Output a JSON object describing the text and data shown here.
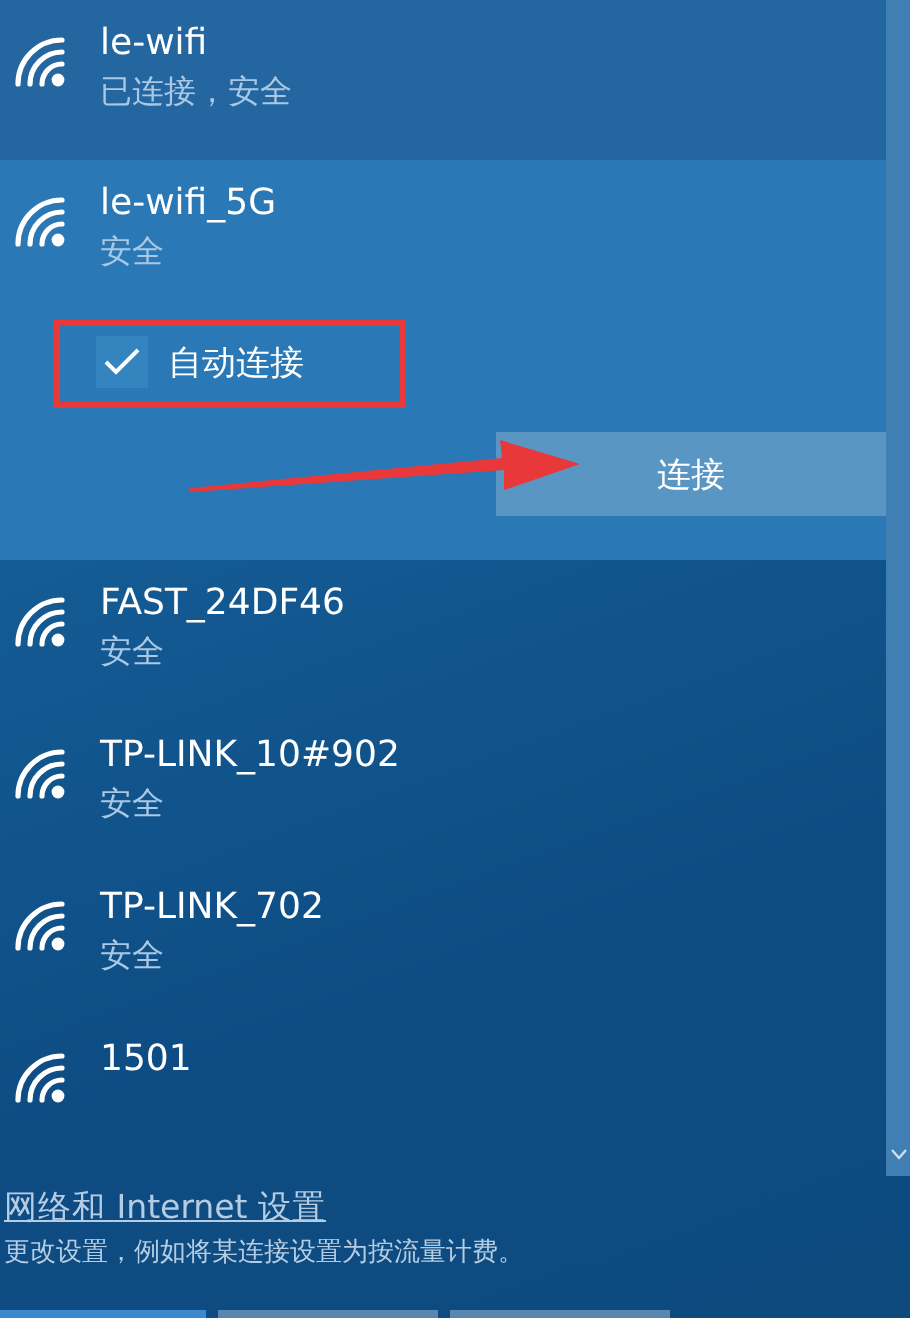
{
  "networks": [
    {
      "name": "le-wifi",
      "status": "已连接，安全",
      "connected": true,
      "selected": false
    },
    {
      "name": "le-wifi_5G",
      "status": "安全",
      "connected": false,
      "selected": true,
      "auto_connect": {
        "label": "自动连接",
        "checked": true
      },
      "connect_button": "连接"
    },
    {
      "name": "FAST_24DF46",
      "status": "安全",
      "connected": false,
      "selected": false
    },
    {
      "name": "TP-LINK_10#902",
      "status": "安全",
      "connected": false,
      "selected": false
    },
    {
      "name": "TP-LINK_702",
      "status": "安全",
      "connected": false,
      "selected": false
    },
    {
      "name": "1501",
      "connected": false,
      "selected": false
    }
  ],
  "footer": {
    "link": "网络和 Internet 设置",
    "description": "更改设置，例如将某连接设置为按流量计费。"
  }
}
